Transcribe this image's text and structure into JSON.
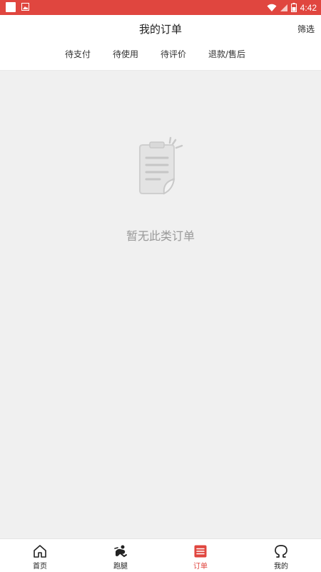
{
  "status_bar": {
    "time": "4:42"
  },
  "header": {
    "title": "我的订单",
    "filter_label": "筛选"
  },
  "tabs": [
    {
      "label": "待支付"
    },
    {
      "label": "待使用"
    },
    {
      "label": "待评价"
    },
    {
      "label": "退款/售后"
    }
  ],
  "empty_state": {
    "message": "暂无此类订单"
  },
  "bottom_nav": [
    {
      "label": "首页",
      "icon": "home-icon"
    },
    {
      "label": "跑腿",
      "icon": "errand-runner-icon"
    },
    {
      "label": "订单",
      "icon": "order-list-icon",
      "active": true
    },
    {
      "label": "我的",
      "icon": "profile-icon"
    }
  ],
  "colors": {
    "accent": "#e0463f",
    "empty_text": "#999999"
  }
}
